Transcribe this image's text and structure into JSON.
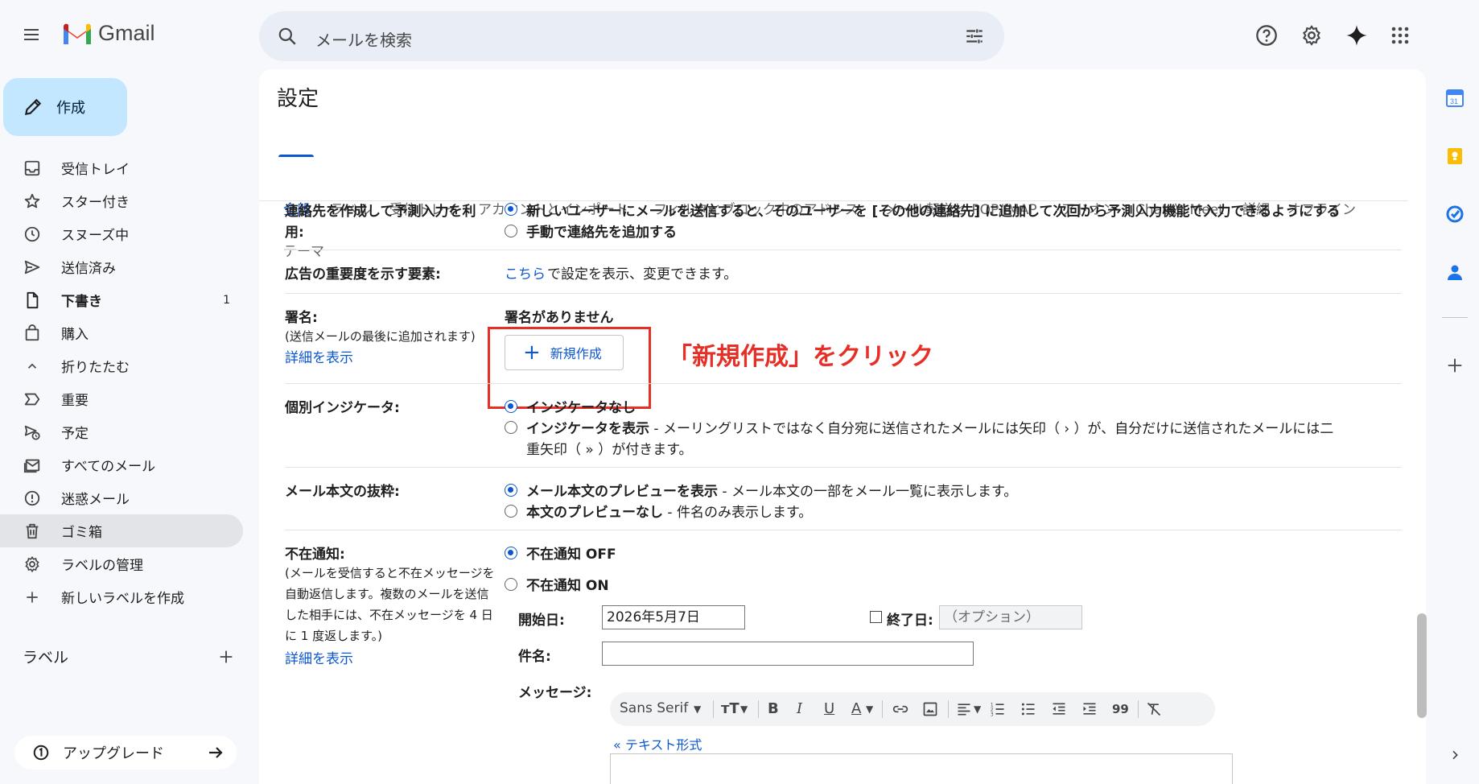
{
  "app": {
    "name": "Gmail"
  },
  "search": {
    "placeholder": "メールを検索"
  },
  "compose": {
    "label": "作成"
  },
  "nav": {
    "items": [
      {
        "label": "受信トレイ",
        "icon": "inbox-icon"
      },
      {
        "label": "スター付き",
        "icon": "star-icon"
      },
      {
        "label": "スヌーズ中",
        "icon": "clock-icon"
      },
      {
        "label": "送信済み",
        "icon": "send-icon"
      },
      {
        "label": "下書き",
        "icon": "draft-icon",
        "count": "1"
      },
      {
        "label": "購入",
        "icon": "bag-icon"
      },
      {
        "label": "折りたたむ",
        "icon": "chevron-up-icon"
      },
      {
        "label": "重要",
        "icon": "important-icon"
      },
      {
        "label": "予定",
        "icon": "scheduled-icon"
      },
      {
        "label": "すべてのメール",
        "icon": "all-mail-icon"
      },
      {
        "label": "迷惑メール",
        "icon": "spam-icon"
      },
      {
        "label": "ゴミ箱",
        "icon": "trash-icon"
      },
      {
        "label": "ラベルの管理",
        "icon": "gear-icon"
      },
      {
        "label": "新しいラベルを作成",
        "icon": "plus-icon"
      }
    ],
    "labels_heading": "ラベル",
    "upgrade_label": "アップグレード"
  },
  "settings": {
    "title": "設定",
    "tabs": [
      "全般",
      "ラベル",
      "受信トレイ",
      "アカウントとインポート",
      "フィルタとブロック中のアドレス",
      "メール転送と POP/IMAP",
      "アドオン",
      "Chat と Meet",
      "詳細",
      "オフライン",
      "テーマ"
    ],
    "active_tab": "全般",
    "contacts": {
      "label_line1": "連絡先を作成して予測入力を利",
      "label_line2": "用:",
      "option1": "新しいユーザーにメールを送信すると、そのユーザーを [その他の連絡先] に追加して次回から予測入力機能で入力できるようにする",
      "option2": "手動で連絡先を追加する"
    },
    "ads": {
      "label": "広告の重要度を示す要素:",
      "link": "こちら",
      "text": "で設定を表示、変更できます。"
    },
    "signature": {
      "label": "署名:",
      "note": "(送信メールの最後に追加されます)",
      "details_link": "詳細を表示",
      "empty": "署名がありません",
      "new_button": "新規作成",
      "annotation": "「新規作成」をクリック"
    },
    "indicator": {
      "label": "個別インジケータ:",
      "option1": "インジケータなし",
      "option2_bold": "インジケータを表示",
      "option2_text": " - メーリングリストではなく自分宛に送信されたメールには矢印（ › ）が、自分だけに送信されたメールには二",
      "option2_text2": "重矢印（ » ）が付きます。"
    },
    "snippets": {
      "label": "メール本文の抜粋:",
      "option1_bold": "メール本文のプレビューを表示",
      "option1_text": " - メール本文の一部をメール一覧に表示します。",
      "option2_bold": "本文のプレビューなし",
      "option2_text": " - 件名のみ表示します。"
    },
    "vacation": {
      "label": "不在通知:",
      "note_lines": [
        "(メールを受信すると不在メッセージを",
        "自動返信します。複数のメールを送信",
        "した相手には、不在メッセージを 4 日",
        "に 1 度返します。)"
      ],
      "details_link": "詳細を表示",
      "off": "不在通知 OFF",
      "on": "不在通知 ON",
      "start_label": "開始日:",
      "start_value": "2026年5月7日",
      "end_label": "終了日:",
      "end_placeholder": "（オプション）",
      "subject_label": "件名:",
      "message_label": "メッセージ:",
      "font": "Sans Serif",
      "plain_text_link": "« テキスト形式"
    }
  },
  "colors": {
    "accent": "#0b57d0",
    "annotation": "#e63027",
    "compose_bg": "#c2e7ff"
  }
}
